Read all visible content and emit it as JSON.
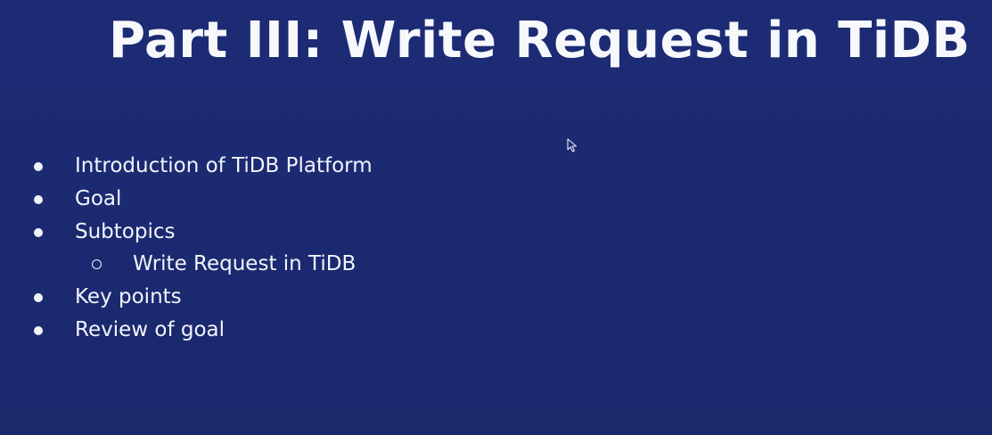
{
  "slide": {
    "title": "Part III: Write Request in TiDB",
    "bullets": [
      {
        "text": "Introduction of TiDB Platform",
        "level": 1
      },
      {
        "text": "Goal",
        "level": 1
      },
      {
        "text": "Subtopics",
        "level": 1
      },
      {
        "text": "Write Request in TiDB",
        "level": 2
      },
      {
        "text": "Key points",
        "level": 1
      },
      {
        "text": "Review of goal",
        "level": 1
      }
    ]
  },
  "colors": {
    "background": "#1b2a72",
    "text": "#f2f4fb"
  },
  "icons": {
    "pointer": "mouse-pointer-icon",
    "bullet": "filled-circle-bullet-icon",
    "sub_bullet": "hollow-circle-bullet-icon"
  }
}
